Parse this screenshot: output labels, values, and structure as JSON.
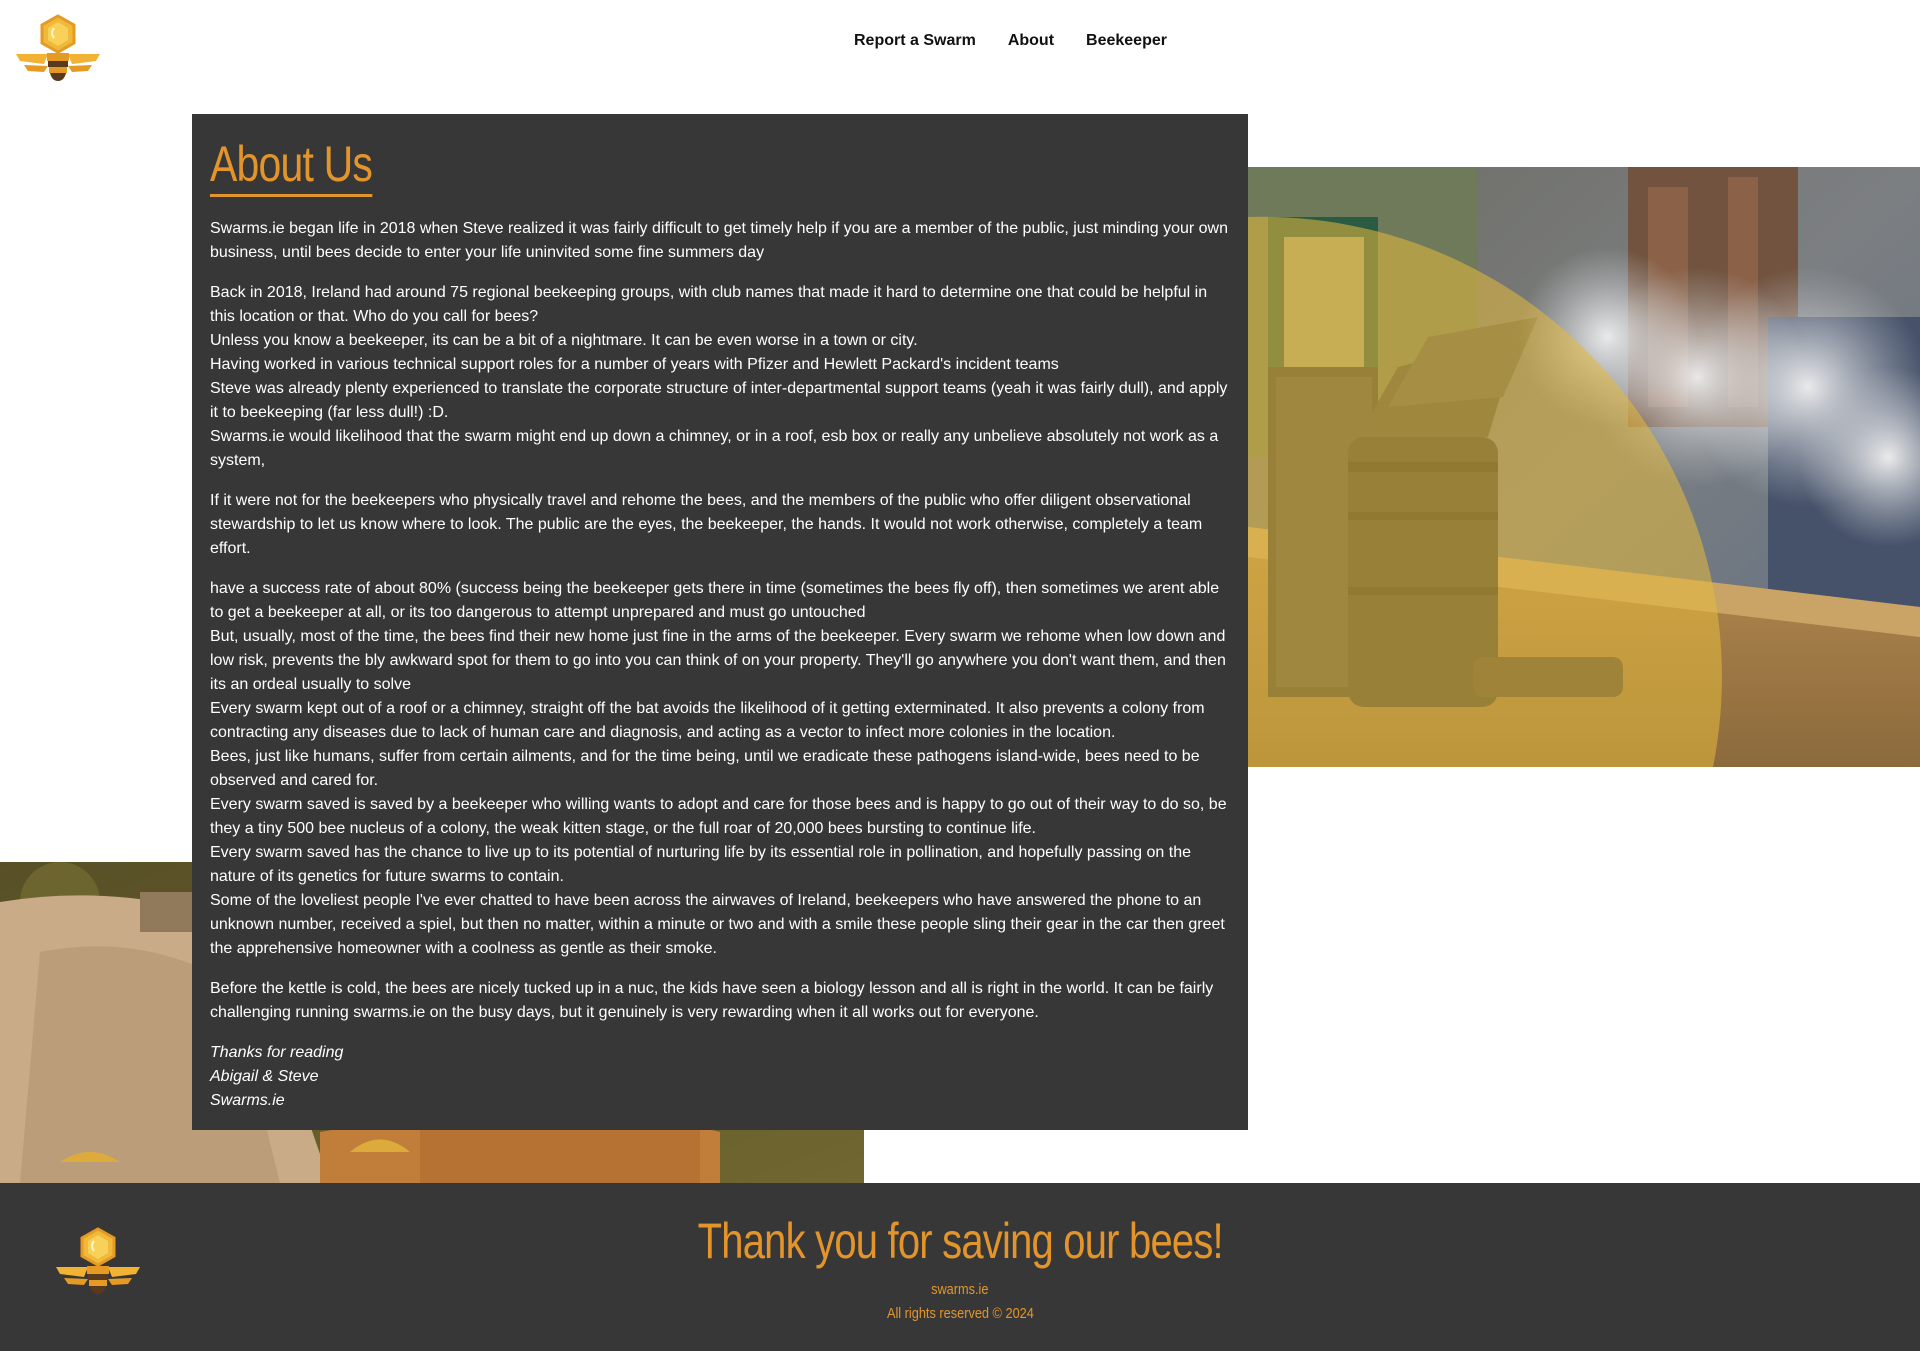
{
  "header": {
    "logo_icon": "bee-hex-logo-icon",
    "nav": [
      {
        "label": "Report a Swarm"
      },
      {
        "label": "About"
      },
      {
        "label": "Beekeeper"
      }
    ]
  },
  "about": {
    "title": "About Us",
    "paragraphs": [
      [
        "Swarms.ie began life in 2018 when Steve realized it was fairly difficult to get timely help if you are a member of the public, just minding your own business, until bees decide to enter your life uninvited some fine summers day"
      ],
      [
        "Back in 2018, Ireland had around 75 regional beekeeping groups, with club names that made it hard to determine one that could be helpful in this location or that. Who do you call for bees?",
        "Unless you know a beekeeper, its can be a bit of a nightmare. It can be even worse in a town or city.",
        "Having worked in various technical support roles for a number of years with Pfizer and Hewlett Packard's incident teams",
        "Steve was already plenty experienced to translate the corporate structure of inter-departmental support teams (yeah it was fairly dull), and apply it to beekeeping (far less dull!) :D.",
        "Swarms.ie would likelihood that the swarm might end up down a chimney, or in a roof, esb box or really any unbelieve absolutely not work as a system,"
      ],
      [
        "If it were not for the beekeepers who physically travel and rehome the bees, and the members of the public who offer diligent observational stewardship to let us know where to look. The public are the eyes, the beekeeper, the hands. It would not work otherwise, completely a team effort."
      ],
      [
        "have a success rate of about 80% (success being the beekeeper gets there in time (sometimes the bees fly off), then sometimes we arent able to get a beekeeper at all, or its too dangerous to attempt unprepared and must go untouched",
        "But, usually, most of the time, the bees find their new home just fine in the arms of the beekeeper. Every swarm we rehome when low down and low risk, prevents the bly awkward spot for them to go into you can think of on your property. They'll go anywhere you don't want them, and then its an ordeal usually to solve",
        "Every swarm kept out of a roof or a chimney, straight off the bat avoids the likelihood of it getting exterminated. It also prevents a colony from contracting any diseases due to lack of human care and diagnosis, and acting as a vector to infect more colonies in the location.",
        "Bees, just like humans, suffer from certain ailments, and for the time being, until we eradicate these pathogens island-wide, bees need to be observed and cared for.",
        "Every swarm saved is saved by a beekeeper who willing wants to adopt and care for those bees and is happy to go out of their way to do so, be they a tiny 500 bee nucleus of a colony, the weak kitten stage, or the full roar of 20,000 bees bursting to continue life.",
        "Every swarm saved has the chance to live up to its potential of nurturing life by its essential role in pollination, and hopefully passing on the nature of its genetics for future swarms to contain.",
        "Some of the loveliest people I've ever chatted to have been across the airwaves of Ireland, beekeepers who have answered the phone to an unknown number, received a spiel, but then no matter, within a minute or two and with a smile these people sling their gear in the car then greet the apprehensive homeowner with a coolness as gentle as their smoke."
      ],
      [
        "Before the kettle is cold, the bees are nicely tucked up in a nuc, the kids have seen a biology lesson and all is right in the world. It can be fairly challenging running swarms.ie on the busy days, but it genuinely is very rewarding when it all works out for everyone."
      ]
    ],
    "signoff": [
      "Thanks for reading",
      "Abigail & Steve",
      "Swarms.ie"
    ]
  },
  "footer": {
    "logo_icon": "bee-hex-logo-icon",
    "heading": "Thank you for saving our bees!",
    "site": "swarms.ie",
    "rights": "All rights reserved © 2024"
  },
  "colors": {
    "accent": "#e3952c",
    "panel": "#383737",
    "text_on_panel": "#ffffff"
  }
}
